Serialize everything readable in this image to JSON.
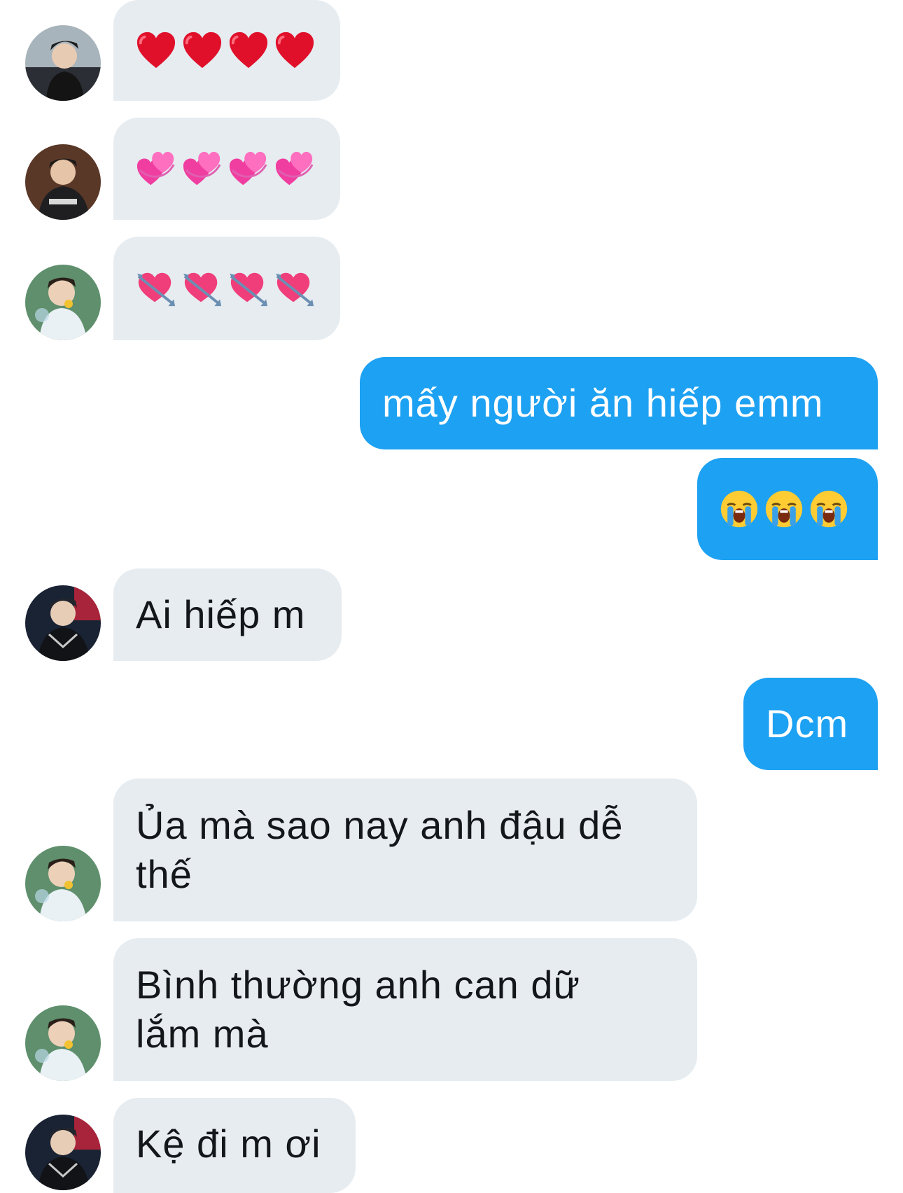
{
  "colors": {
    "incoming_bubble": "#e6ecf0",
    "outgoing_bubble": "#1da1f2",
    "incoming_text": "#14171a",
    "outgoing_text": "#ffffff"
  },
  "messages": [
    {
      "direction": "in",
      "avatar": "user-avatar-photo",
      "content_type": "emoji",
      "emoji": [
        "red-heart-icon",
        "red-heart-icon",
        "red-heart-icon",
        "red-heart-icon"
      ]
    },
    {
      "direction": "in",
      "avatar": "user-avatar-photo",
      "content_type": "emoji",
      "emoji": [
        "two-hearts-icon",
        "two-hearts-icon",
        "two-hearts-icon",
        "two-hearts-icon"
      ]
    },
    {
      "direction": "in",
      "avatar": "user-avatar-photo",
      "content_type": "emoji",
      "emoji": [
        "heart-with-arrow-icon",
        "heart-with-arrow-icon",
        "heart-with-arrow-icon",
        "heart-with-arrow-icon"
      ]
    },
    {
      "direction": "out",
      "content_type": "text",
      "text": "mấy người ăn hiếp emm"
    },
    {
      "direction": "out",
      "content_type": "emoji",
      "emoji": [
        "loudly-crying-face-icon",
        "loudly-crying-face-icon",
        "loudly-crying-face-icon"
      ]
    },
    {
      "direction": "in",
      "avatar": "user-avatar-photo",
      "content_type": "text",
      "text": "Ai hiếp m"
    },
    {
      "direction": "out",
      "content_type": "text",
      "text": "Dcm"
    },
    {
      "direction": "in",
      "avatar": "user-avatar-photo",
      "content_type": "text",
      "lines": [
        "Ủa mà sao nay anh đậu dễ",
        "thế"
      ]
    },
    {
      "direction": "in",
      "avatar": "user-avatar-photo",
      "content_type": "text",
      "lines": [
        "Bình thường anh can dữ",
        "lắm mà"
      ]
    },
    {
      "direction": "in",
      "avatar": "user-avatar-photo",
      "content_type": "text",
      "text": "Kệ đi m ơi"
    }
  ]
}
